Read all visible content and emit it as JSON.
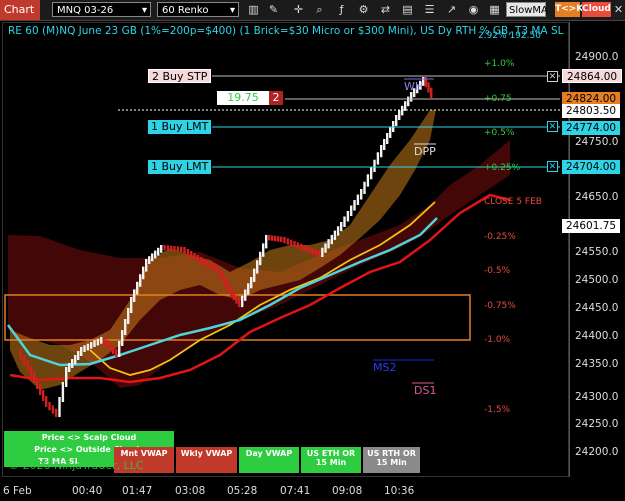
{
  "toolbar": {
    "chart_tab": "Chart",
    "instrument": "MNQ 03-26",
    "interval": "60 Renko",
    "indicator_button": "SlowMA",
    "tck_button": "T<>K",
    "cloud_button": "Cloud"
  },
  "chart": {
    "title": "RE 60 (M)NQ June 23 GB (1%=200p=$400) (1 Brick=$30 Micro or $300 Mini), US Dy RTH % GB, T3 MA SL",
    "title_suffix": "2.92%  192.50",
    "watermark": "© 2026 NinjaTrader, LLC",
    "price_ticks": [
      "24900.0",
      "24750.0",
      "24650.0",
      "24550.0",
      "24500.0",
      "24450.0",
      "24400.0",
      "24350.0",
      "24300.0",
      "24250.0",
      "24200.0"
    ],
    "time_ticks": [
      "6 Feb",
      "00:40",
      "01:47",
      "03:08",
      "05:28",
      "07:41",
      "09:08",
      "10:36"
    ],
    "price_labels": [
      {
        "text": "24864.00",
        "kind": "order"
      },
      {
        "text": "24824.00",
        "kind": "last"
      },
      {
        "text": "24803.50",
        "kind": "current"
      },
      {
        "text": "24774.00",
        "kind": "order"
      },
      {
        "text": "24704.00",
        "kind": "order"
      },
      {
        "text": "24601.75",
        "kind": "current"
      }
    ],
    "orders": [
      {
        "label": "2 Buy STP",
        "type": "stop"
      },
      {
        "label": "1 Buy LMT",
        "type": "limit"
      },
      {
        "label": "1 Buy LMT",
        "type": "limit"
      }
    ],
    "position": {
      "pnl": "19.75",
      "qty": "2"
    },
    "pct_levels": [
      "+1.0%",
      "+0.75",
      "+0.5%",
      "+0.25%",
      "-0.25%",
      "-0.5%",
      "-0.75%",
      "-1.0%",
      "-1.5%"
    ],
    "level_labels": {
      "wh": "WH",
      "dpp": "DPP",
      "close": "CLOSE 5 FEB",
      "ms2": "MS2",
      "ds1": "DS1"
    },
    "buttons": {
      "scalp_cloud": "Price <> Scalp Cloud",
      "outside_clouds": "Price <> Outside Clouds",
      "t3_ma": "T3 MA SL",
      "mnt_vwap": "Mnt VWAP",
      "wkly_vwap": "Wkly VWAP",
      "day_vwap": "Day VWAP",
      "eth_or": "US ETH OR 15 Min",
      "rth_or": "US RTH OR 15 Min"
    },
    "colors": {
      "cyan": "#2ed3e6",
      "orange": "#e67e22",
      "red": "#c0392b",
      "green": "#2ecc40",
      "yellow": "#f1c40f"
    }
  }
}
